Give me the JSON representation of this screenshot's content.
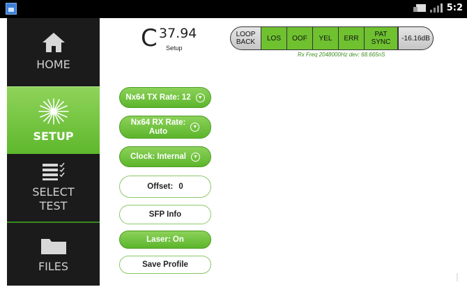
{
  "status_bar": {
    "time": "5:2"
  },
  "sidebar": {
    "items": [
      {
        "label": "HOME",
        "icon": "home-icon"
      },
      {
        "label": "SETUP",
        "icon": "sparkle-icon"
      },
      {
        "label_line1": "SELECT",
        "label_line2": "TEST",
        "icon": "checklist-icon"
      },
      {
        "label": "FILES",
        "icon": "folder-icon"
      }
    ]
  },
  "readout": {
    "prefix": "C",
    "value": "37.94",
    "subtitle": "Setup"
  },
  "alarms": [
    {
      "label_line1": "LOOP",
      "label_line2": "BACK",
      "state": "gray"
    },
    {
      "label": "LOS",
      "state": "green"
    },
    {
      "label": "OOF",
      "state": "green"
    },
    {
      "label": "YEL",
      "state": "green"
    },
    {
      "label": "ERR",
      "state": "green"
    },
    {
      "label": "PAT SYNC",
      "state": "green"
    },
    {
      "label": "-16.16dB",
      "state": "gray"
    }
  ],
  "rx_freq": "Rx Freq 2048000Hz dev: 68.665nS",
  "settings": {
    "tx_rate": "Nx64 TX Rate: 12",
    "rx_rate_line1": "Nx64 RX Rate:",
    "rx_rate_line2": "Auto",
    "clock": "Clock: Internal",
    "offset_label": "Offset:",
    "offset_value": "0",
    "sfp_info": "SFP Info",
    "laser": "Laser: On",
    "save_profile": "Save Profile"
  },
  "colors": {
    "accent_green": "#6fc130",
    "sidebar_bg": "#1b1b1b",
    "freq_text": "#3b8d1c"
  }
}
